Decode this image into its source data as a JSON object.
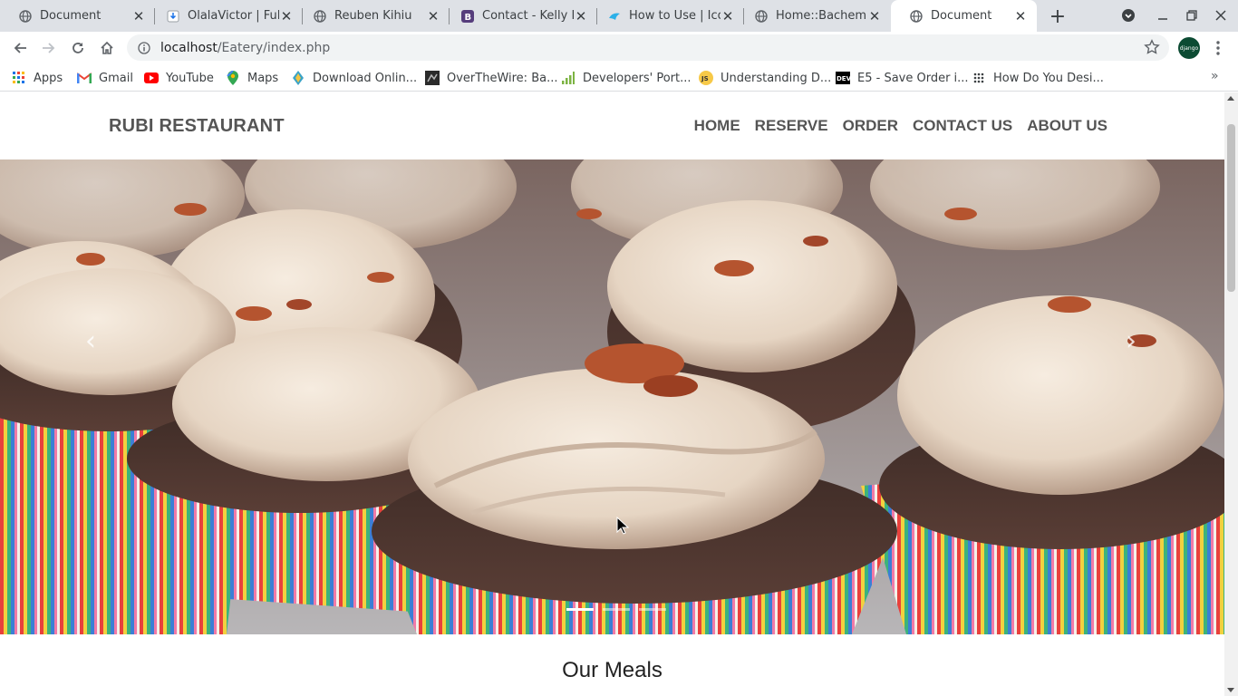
{
  "browser": {
    "tabs": [
      {
        "title": "Document",
        "favicon": "globe-icon",
        "active": false
      },
      {
        "title": "OlalaVictor | Full",
        "favicon": "download-icon",
        "active": false
      },
      {
        "title": "Reuben Kihiu",
        "favicon": "globe-icon",
        "active": false
      },
      {
        "title": "Contact - Kelly B",
        "favicon": "bootstrap-icon",
        "active": false
      },
      {
        "title": "How to Use | Icof",
        "favicon": "bird-icon",
        "active": false
      },
      {
        "title": "Home::Bachem S",
        "favicon": "globe-icon",
        "active": false
      },
      {
        "title": "Document",
        "favicon": "globe-icon",
        "active": true
      }
    ],
    "url": {
      "host": "localhost",
      "path": "/Eatery/index.php"
    },
    "profile_label": "django",
    "bookmarks": [
      {
        "label": "Apps",
        "icon": "apps-grid-icon"
      },
      {
        "label": "Gmail",
        "icon": "gmail-icon"
      },
      {
        "label": "YouTube",
        "icon": "youtube-icon"
      },
      {
        "label": "Maps",
        "icon": "maps-icon"
      },
      {
        "label": "Download Onlin...",
        "icon": "download-site-icon"
      },
      {
        "label": "OverTheWire: Ba...",
        "icon": "overthewire-icon"
      },
      {
        "label": "Developers' Port...",
        "icon": "signal-bars-icon"
      },
      {
        "label": "Understanding D...",
        "icon": "js-icon"
      },
      {
        "label": "E5 - Save Order i...",
        "icon": "dev-icon"
      },
      {
        "label": "How Do You Desi...",
        "icon": "dots-grid-icon"
      }
    ]
  },
  "site": {
    "brand": "RUBI RESTAURANT",
    "nav": [
      "HOME",
      "RESERVE",
      "ORDER",
      "CONTACT US",
      "ABOUT US"
    ],
    "carousel": {
      "slides": 3,
      "active_slide": 1,
      "image": "cupcakes"
    },
    "section_title": "Our Meals"
  },
  "colors": {
    "tabstrip": "#dee1e6",
    "brand_text": "#555555",
    "profile": "#0c4b33"
  }
}
